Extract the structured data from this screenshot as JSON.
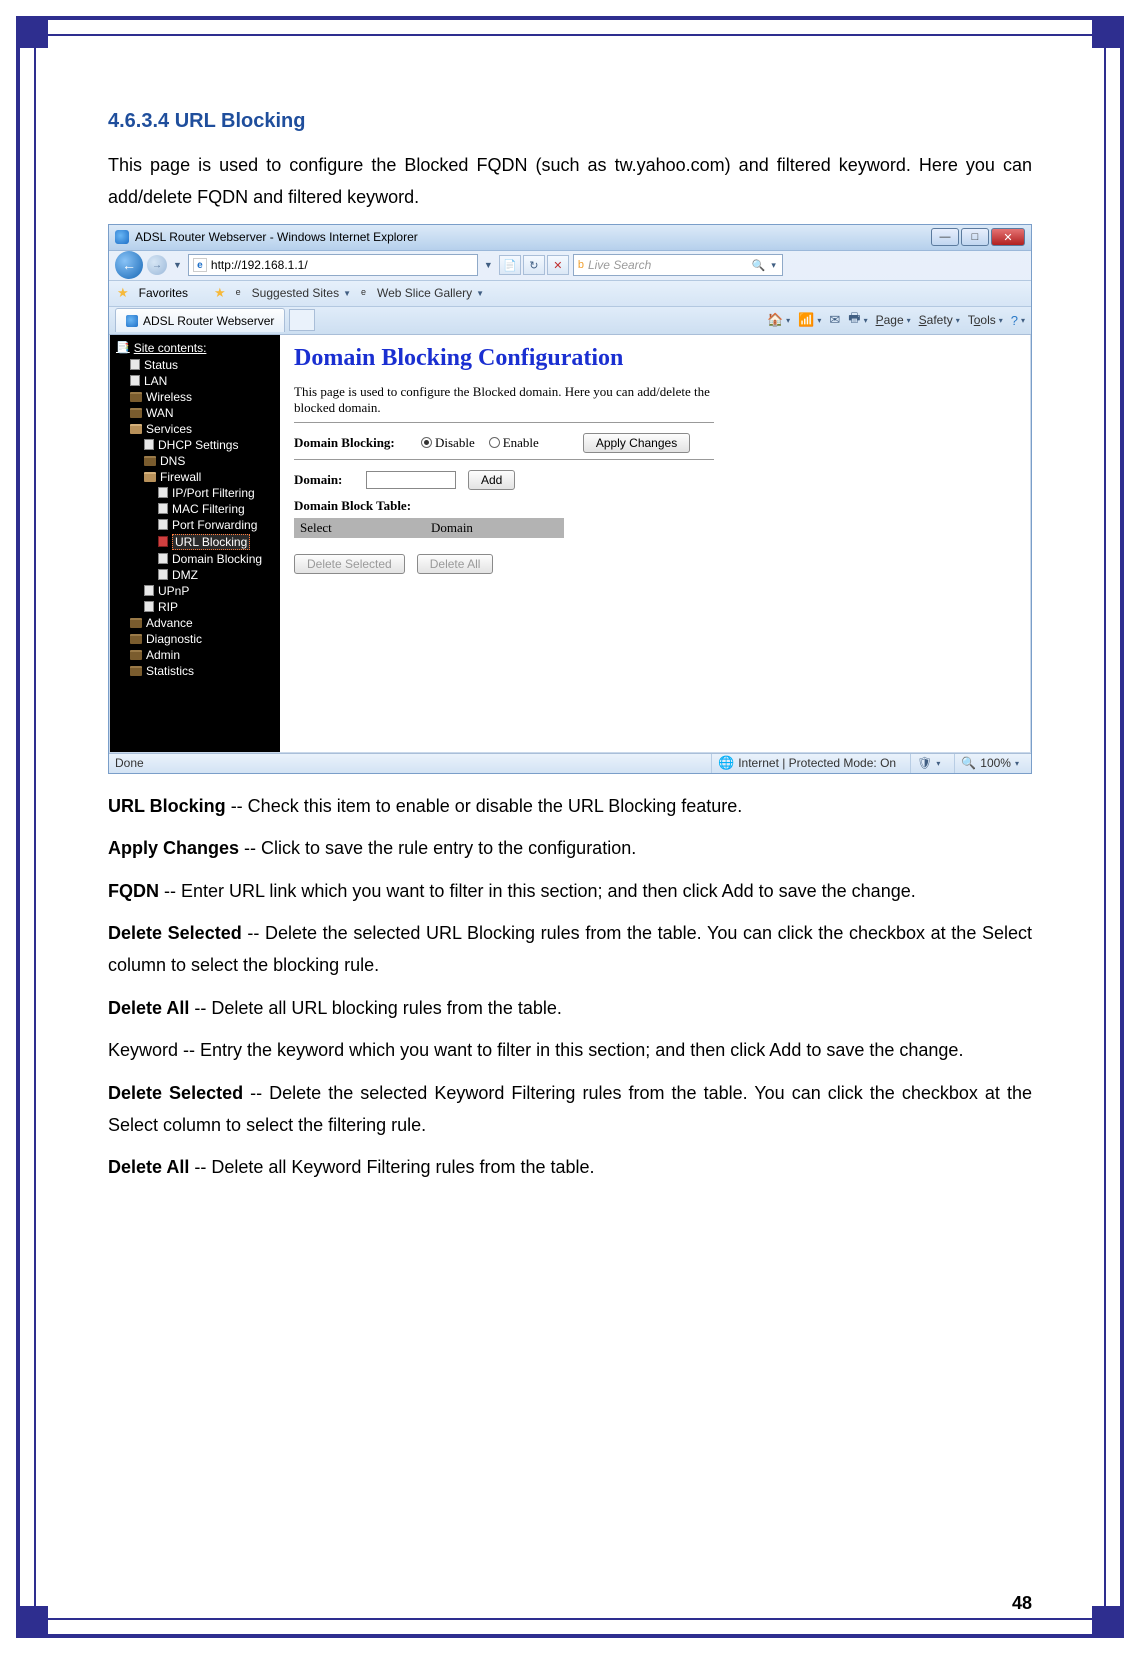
{
  "section": {
    "number": "4.6.3.4",
    "title": "URL Blocking",
    "intro": "This page is used to configure the Blocked FQDN (such as tw.yahoo.com) and filtered keyword. Here you can add/delete FQDN and filtered keyword."
  },
  "ie": {
    "window_title": "ADSL Router Webserver - Windows Internet Explorer",
    "url": "http://192.168.1.1/",
    "search_placeholder": "Live Search",
    "favorites_label": "Favorites",
    "suggested_sites": "Suggested Sites",
    "web_slice": "Web Slice Gallery",
    "tab_title": "ADSL Router Webserver",
    "toolbar": {
      "page": "Page",
      "safety": "Safety",
      "tools": "Tools"
    },
    "status": {
      "done": "Done",
      "zone": "Internet | Protected Mode: On",
      "zoom": "100%"
    }
  },
  "sidebar": {
    "title": "Site contents:",
    "items": {
      "status": "Status",
      "lan": "LAN",
      "wireless": "Wireless",
      "wan": "WAN",
      "services": "Services",
      "dhcp": "DHCP Settings",
      "dns": "DNS",
      "firewall": "Firewall",
      "ipport": "IP/Port Filtering",
      "mac": "MAC Filtering",
      "portfwd": "Port Forwarding",
      "urlblock": "URL Blocking",
      "domblock": "Domain Blocking",
      "dmz": "DMZ",
      "upnp": "UPnP",
      "rip": "RIP",
      "advance": "Advance",
      "diagnostic": "Diagnostic",
      "admin": "Admin",
      "statistics": "Statistics"
    }
  },
  "main": {
    "title": "Domain Blocking Configuration",
    "desc": "This page is used to configure the Blocked domain. Here you can add/delete the blocked domain.",
    "domain_blocking_label": "Domain Blocking:",
    "disable": "Disable",
    "enable": "Enable",
    "apply": "Apply Changes",
    "domain_label": "Domain:",
    "add": "Add",
    "table_title": "Domain Block Table:",
    "th_select": "Select",
    "th_domain": "Domain",
    "delete_selected": "Delete Selected",
    "delete_all": "Delete All"
  },
  "descriptions": {
    "url_blocking_label": "URL Blocking",
    "url_blocking_text": " -- Check this item to enable or disable the URL Blocking feature.",
    "apply_label": "Apply Changes",
    "apply_text": " -- Click to save the rule entry to the configuration.",
    "fqdn_label": "FQDN",
    "fqdn_text": " -- Enter URL link which you want to filter in this section; and then click Add to save the change.",
    "del_sel_label": "Delete Selected",
    "del_sel_text": " -- Delete the selected URL Blocking rules from the table. You can click the checkbox at the Select column to select the blocking rule.",
    "del_all_label": "Delete All",
    "del_all_text": " -- Delete all URL blocking rules from the table.",
    "keyword_text": "Keyword -- Entry the keyword which you want to filter in this section; and then click Add to save the change.",
    "del_sel2_label": "Delete Selected",
    "del_sel2_text": " -- Delete the selected Keyword Filtering rules from the table. You can click the checkbox at the Select column to select the filtering rule.",
    "del_all2_label": "Delete All",
    "del_all2_text": " -- Delete all Keyword Filtering rules from the table."
  },
  "page_number": "48"
}
